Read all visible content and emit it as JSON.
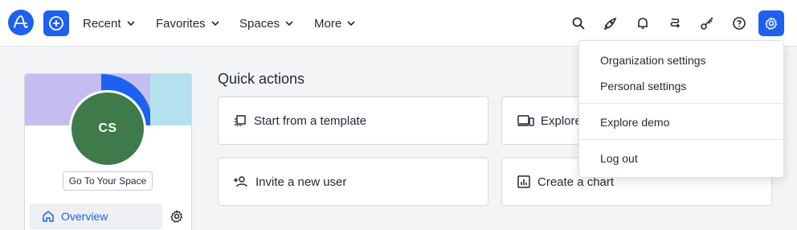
{
  "nav": {
    "menus": [
      {
        "label": "Recent"
      },
      {
        "label": "Favorites"
      },
      {
        "label": "Spaces"
      },
      {
        "label": "More"
      }
    ]
  },
  "space_card": {
    "initials": "CS",
    "goto_label": "Go To Your Space",
    "overview_label": "Overview"
  },
  "quick_actions": {
    "title": "Quick actions",
    "items": [
      {
        "label": "Start from a template"
      },
      {
        "label": "Explore A"
      },
      {
        "label": "Invite a new user"
      },
      {
        "label": "Create a chart"
      }
    ]
  },
  "settings_menu": {
    "items": [
      {
        "label": "Organization settings"
      },
      {
        "label": "Personal settings"
      },
      {
        "label": "Explore demo"
      },
      {
        "label": "Log out"
      }
    ]
  },
  "colors": {
    "accent": "#1e61f0",
    "avatar": "#3f7a4a",
    "banner_purple": "#c5bdf0",
    "banner_light_blue": "#b5e1ef"
  }
}
